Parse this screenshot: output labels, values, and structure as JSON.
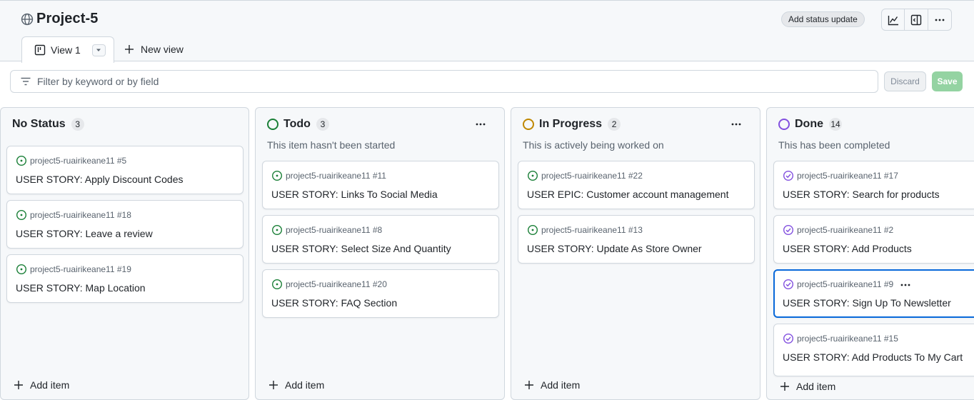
{
  "header": {
    "project_title": "Project-5",
    "status_update_label": "Add status update",
    "icons": [
      "insights-icon",
      "side-panel-icon",
      "more-options-icon"
    ]
  },
  "tabs": {
    "active_label": "View 1",
    "new_view_label": "New view"
  },
  "filter": {
    "placeholder": "Filter by keyword or by field",
    "value": "",
    "discard_label": "Discard",
    "save_label": "Save"
  },
  "colors": {
    "todo": "#1a7f37",
    "in_progress": "#bf8700",
    "done": "#8250df",
    "open_issue": "#1a7f37",
    "closed_issue": "#8250df",
    "selected_border": "#0969da",
    "save_button": "#94d3a2"
  },
  "columns": [
    {
      "title": "No Status",
      "count": "3",
      "description": "",
      "add_item_label": "Add item",
      "cards": [
        {
          "repo": "project5-ruairikeane11 #5",
          "title": "USER STORY: Apply Discount Codes",
          "status": "open"
        },
        {
          "repo": "project5-ruairikeane11 #18",
          "title": "USER STORY: Leave a review",
          "status": "open"
        },
        {
          "repo": "project5-ruairikeane11 #19",
          "title": "USER STORY: Map Location",
          "status": "open"
        }
      ]
    },
    {
      "title": "Todo",
      "count": "3",
      "description": "This item hasn't been started",
      "add_item_label": "Add item",
      "cards": [
        {
          "repo": "project5-ruairikeane11 #11",
          "title": "USER STORY: Links To Social Media",
          "status": "open"
        },
        {
          "repo": "project5-ruairikeane11 #8",
          "title": "USER STORY: Select Size And Quantity",
          "status": "open"
        },
        {
          "repo": "project5-ruairikeane11 #20",
          "title": "USER STORY: FAQ Section",
          "status": "open"
        }
      ]
    },
    {
      "title": "In Progress",
      "count": "2",
      "description": "This is actively being worked on",
      "add_item_label": "Add item",
      "cards": [
        {
          "repo": "project5-ruairikeane11 #22",
          "title": "USER EPIC: Customer account management",
          "status": "open"
        },
        {
          "repo": "project5-ruairikeane11 #13",
          "title": "USER STORY: Update As Store Owner",
          "status": "open"
        }
      ]
    },
    {
      "title": "Done",
      "count": "14",
      "description": "This has been completed",
      "add_item_label": "Add item",
      "cards": [
        {
          "repo": "project5-ruairikeane11 #17",
          "title": "USER STORY: Search for products",
          "status": "closed"
        },
        {
          "repo": "project5-ruairikeane11 #2",
          "title": "USER STORY: Add Products",
          "status": "closed"
        },
        {
          "repo": "project5-ruairikeane11 #9",
          "title": "USER STORY: Sign Up To Newsletter",
          "status": "closed",
          "selected": true
        },
        {
          "repo": "project5-ruairikeane11 #15",
          "title": "USER STORY: Add Products To My Cart",
          "status": "closed"
        }
      ]
    }
  ]
}
